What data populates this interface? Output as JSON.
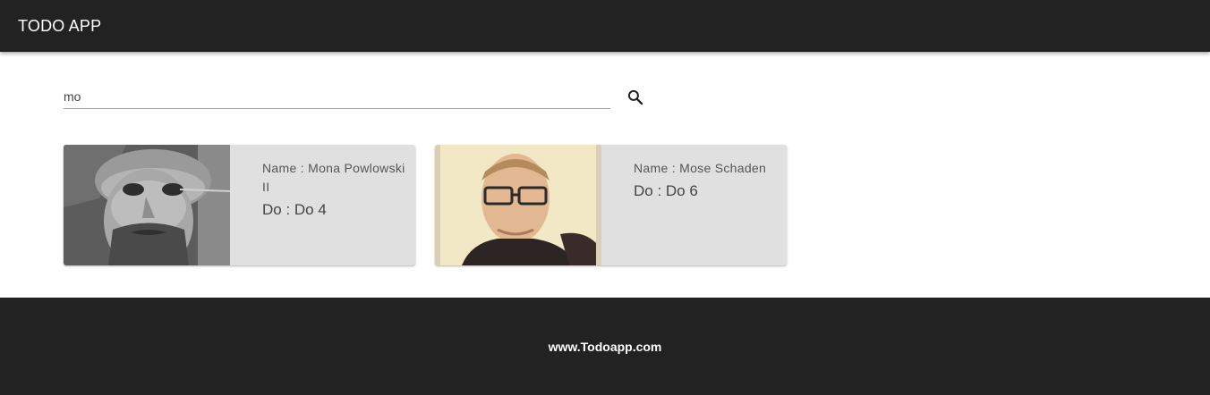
{
  "header": {
    "title": "TODO APP"
  },
  "search": {
    "value": "mo",
    "icon": "search-icon"
  },
  "cards": [
    {
      "name": "Name : Mona Powlowski II",
      "todo": "Do : Do 4",
      "photo": "grayscale-portrait"
    },
    {
      "name": "Name : Mose Schaden",
      "todo": "Do : Do 6",
      "photo": "sepia-portrait-glasses"
    }
  ],
  "footer": {
    "link": "www.Todoapp.com"
  },
  "colors": {
    "bar": "#222222",
    "card": "#e0e0e0",
    "text_white": "#ffffff"
  }
}
